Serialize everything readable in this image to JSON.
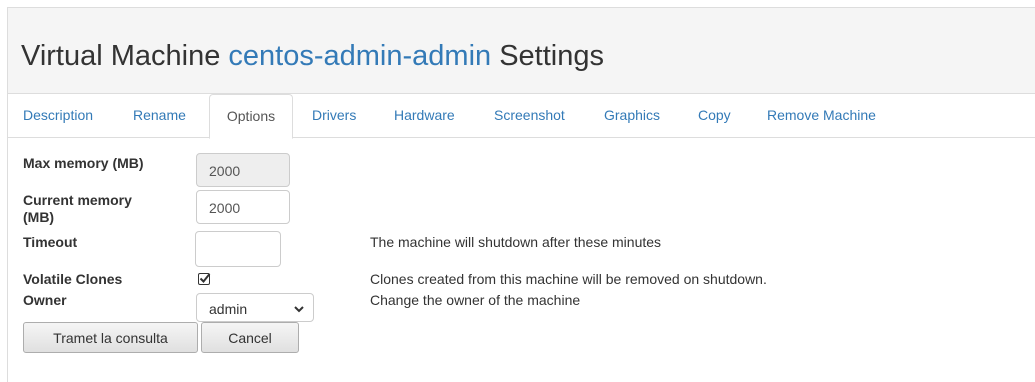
{
  "header": {
    "title_prefix": "Virtual Machine ",
    "vm_name": "centos-admin-admin",
    "title_suffix": " Settings"
  },
  "tabs": [
    {
      "label": "Description"
    },
    {
      "label": "Rename"
    },
    {
      "label": "Options",
      "active": true
    },
    {
      "label": "Drivers"
    },
    {
      "label": "Hardware"
    },
    {
      "label": "Screenshot"
    },
    {
      "label": "Graphics"
    },
    {
      "label": "Copy"
    },
    {
      "label": "Remove Machine"
    }
  ],
  "form": {
    "max_memory": {
      "label": "Max memory (MB)",
      "value": "2000"
    },
    "current_memory": {
      "label_line1": "Current memory",
      "label_line2": "(MB)",
      "value": "2000"
    },
    "timeout": {
      "label": "Timeout",
      "value": "",
      "help": "The machine will shutdown after these minutes"
    },
    "volatile_clones": {
      "label": "Volatile Clones",
      "checked": true,
      "help": "Clones created from this machine will be removed on shutdown."
    },
    "owner": {
      "label": "Owner",
      "value": "admin",
      "help": "Change the owner of the machine"
    }
  },
  "buttons": {
    "submit": "Tramet la consulta",
    "cancel": "Cancel"
  },
  "colors": {
    "link": "#337ab7",
    "heading_bg": "#f5f5f5",
    "border": "#dddddd"
  }
}
